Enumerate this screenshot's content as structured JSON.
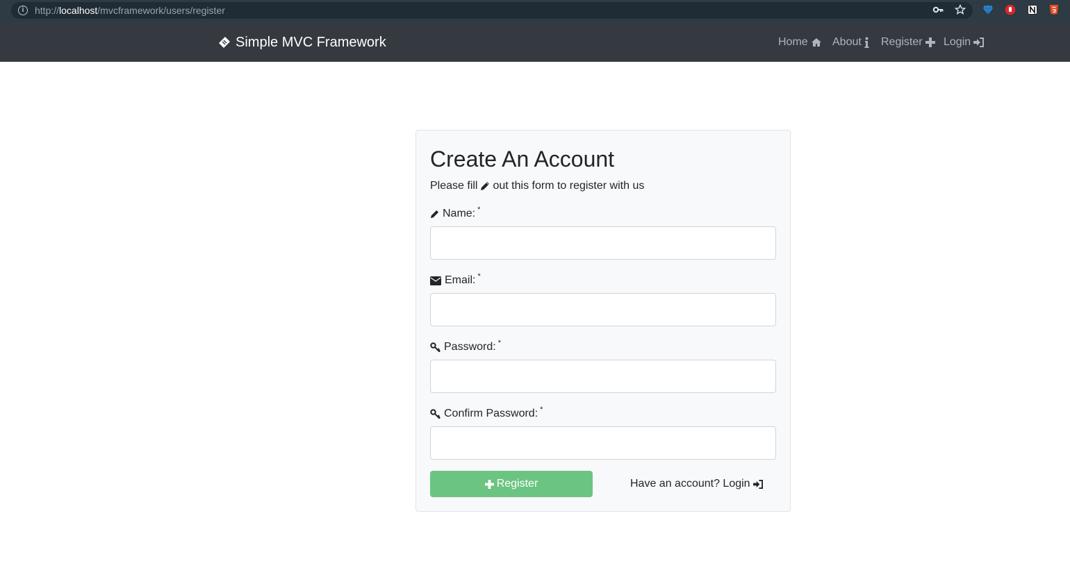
{
  "browser": {
    "url_prefix": "http://",
    "url_host": "localhost",
    "url_path": "/mvcframework/users/register",
    "icons": [
      "info-icon",
      "key-icon",
      "star-icon",
      "extension-gem-icon",
      "extension-stop-icon",
      "extension-notion-icon",
      "extension-html-icon"
    ]
  },
  "navbar": {
    "brand": "Simple MVC Framework",
    "links": [
      {
        "label": "Home",
        "icon": "home-icon"
      },
      {
        "label": "About",
        "icon": "info-icon"
      },
      {
        "label": "Register",
        "icon": "plus-icon"
      },
      {
        "label": "Login",
        "icon": "sign-in-icon"
      }
    ]
  },
  "form": {
    "title": "Create An Account",
    "subtitle_before": "Please fill",
    "subtitle_after": "out this form to register with us",
    "fields": [
      {
        "label": "Name:",
        "required_mark": "*",
        "value": "",
        "icon": "pencil-icon"
      },
      {
        "label": "Email:",
        "required_mark": "*",
        "value": "",
        "icon": "envelope-icon"
      },
      {
        "label": "Password:",
        "required_mark": "*",
        "value": "",
        "icon": "key-icon"
      },
      {
        "label": "Confirm Password:",
        "required_mark": "*",
        "value": "",
        "icon": "key-icon"
      }
    ],
    "submit_label": "Register",
    "login_prompt": "Have an account? Login"
  },
  "colors": {
    "navbar_bg": "#343a40",
    "nav_link": "#adb5bd",
    "card_bg": "#f8f9fa",
    "button_bg": "#6cc482"
  }
}
